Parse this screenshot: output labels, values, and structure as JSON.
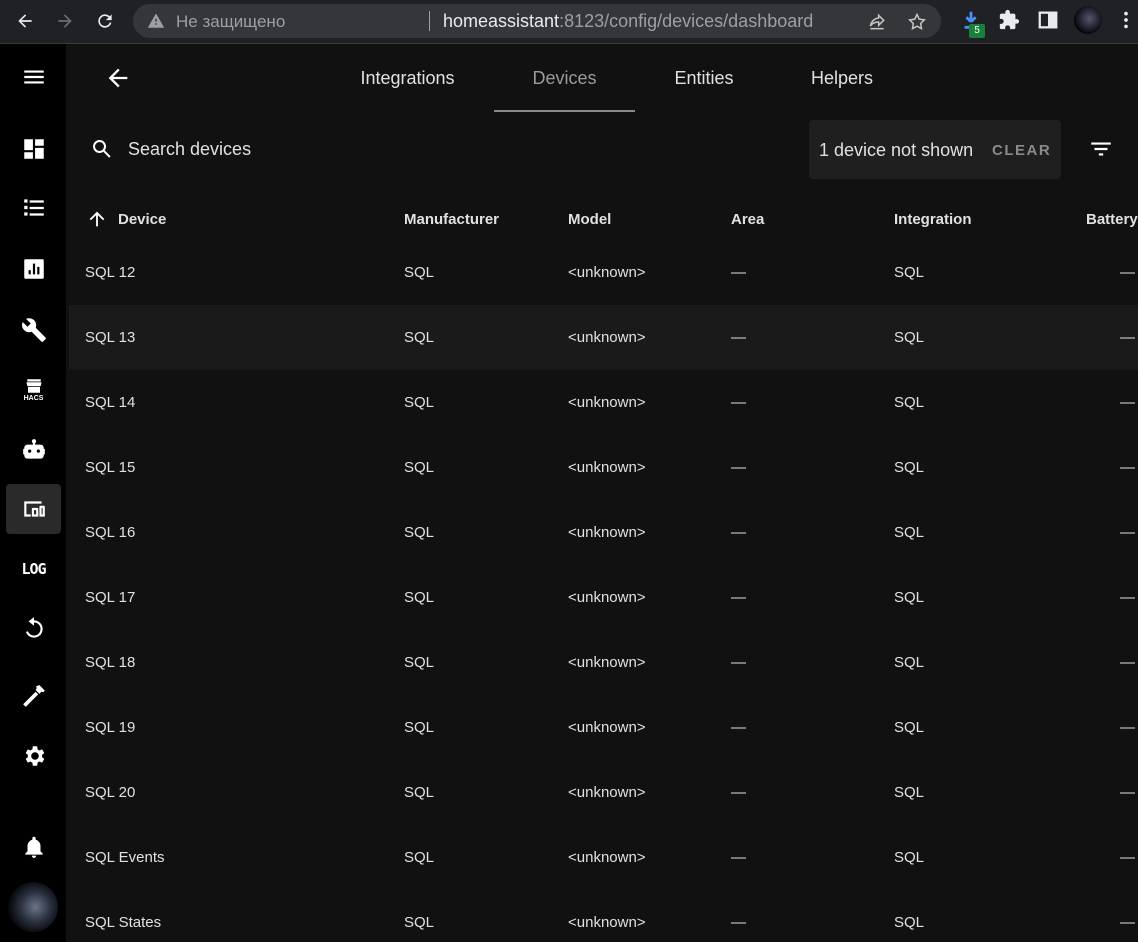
{
  "browser": {
    "insecure_label": "Не защищено",
    "url_host": "homeassistant",
    "url_path": ":8123/config/devices/dashboard",
    "download_badge": "5"
  },
  "tabs": [
    {
      "label": "Integrations",
      "active": false
    },
    {
      "label": "Devices",
      "active": true
    },
    {
      "label": "Entities",
      "active": false
    },
    {
      "label": "Helpers",
      "active": false
    }
  ],
  "toolbar": {
    "search_placeholder": "Search devices",
    "filter_message": "1 device not shown",
    "clear_label": "CLEAR"
  },
  "sidebar": {
    "log_label": "LOG",
    "hacs_label": "HACS",
    "active_item": "devices"
  },
  "table": {
    "columns": [
      "Device",
      "Manufacturer",
      "Model",
      "Area",
      "Integration",
      "Battery"
    ],
    "sort": {
      "column": "Device",
      "direction": "ascending"
    },
    "rows": [
      [
        "SQL 12",
        "SQL",
        "<unknown>",
        "—",
        "SQL",
        "—"
      ],
      [
        "SQL 13",
        "SQL",
        "<unknown>",
        "—",
        "SQL",
        "—"
      ],
      [
        "SQL 14",
        "SQL",
        "<unknown>",
        "—",
        "SQL",
        "—"
      ],
      [
        "SQL 15",
        "SQL",
        "<unknown>",
        "—",
        "SQL",
        "—"
      ],
      [
        "SQL 16",
        "SQL",
        "<unknown>",
        "—",
        "SQL",
        "—"
      ],
      [
        "SQL 17",
        "SQL",
        "<unknown>",
        "—",
        "SQL",
        "—"
      ],
      [
        "SQL 18",
        "SQL",
        "<unknown>",
        "—",
        "SQL",
        "—"
      ],
      [
        "SQL 19",
        "SQL",
        "<unknown>",
        "—",
        "SQL",
        "—"
      ],
      [
        "SQL 20",
        "SQL",
        "<unknown>",
        "—",
        "SQL",
        "—"
      ],
      [
        "SQL Events",
        "SQL",
        "<unknown>",
        "—",
        "SQL",
        "—"
      ],
      [
        "SQL States",
        "SQL",
        "<unknown>",
        "—",
        "SQL",
        "—"
      ]
    ]
  },
  "colors": {
    "background": "#111111",
    "sidebar": "#000000",
    "text": "#e1e1e1",
    "muted": "#8a8a8a"
  }
}
